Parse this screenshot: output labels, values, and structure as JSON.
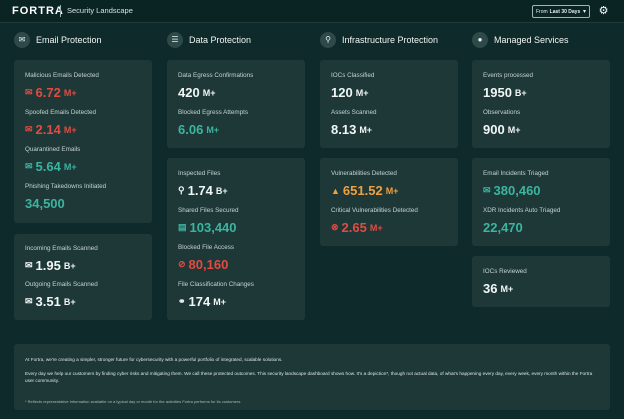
{
  "header": {
    "brand": "FORTRA",
    "title": "Security Landscape",
    "range_prefix": "From",
    "range_value": "Last 30 Days"
  },
  "columns": {
    "email": {
      "title": "Email Protection"
    },
    "data": {
      "title": "Data Protection"
    },
    "infra": {
      "title": "Infrastructure Protection"
    },
    "managed": {
      "title": "Managed Services"
    }
  },
  "email": {
    "malicious": {
      "label": "Malicious Emails Detected",
      "value": "6.72",
      "unit": "M+"
    },
    "spoofed": {
      "label": "Spoofed Emails Detected",
      "value": "2.14",
      "unit": "M+"
    },
    "quarantined": {
      "label": "Quarantined Emails",
      "value": "5.64",
      "unit": "M+"
    },
    "phishing": {
      "label": "Phishing Takedowns Initiated",
      "value": "34,500",
      "unit": ""
    },
    "incoming": {
      "label": "Incoming Emails Scanned",
      "value": "1.95",
      "unit": "B+"
    },
    "outgoing": {
      "label": "Outgoing Emails Scanned",
      "value": "3.51",
      "unit": "B+"
    }
  },
  "data": {
    "egress_conf": {
      "label": "Data Egress Confirmations",
      "value": "420",
      "unit": "M+"
    },
    "egress_blocked": {
      "label": "Blocked Egress Attempts",
      "value": "6.06",
      "unit": "M+"
    },
    "inspected": {
      "label": "Inspected Files",
      "value": "1.74",
      "unit": "B+"
    },
    "shared": {
      "label": "Shared Files Secured",
      "value": "103,440",
      "unit": ""
    },
    "blocked_access": {
      "label": "Blocked File Access",
      "value": "80,160",
      "unit": ""
    },
    "classification": {
      "label": "File Classification Changes",
      "value": "174",
      "unit": "M+"
    }
  },
  "infra": {
    "iocs": {
      "label": "IOCs Classified",
      "value": "120",
      "unit": "M+"
    },
    "assets": {
      "label": "Assets Scanned",
      "value": "8.13",
      "unit": "M+"
    },
    "vulns": {
      "label": "Vulnerabilities Detected",
      "value": "651.52",
      "unit": "M+"
    },
    "critical": {
      "label": "Critical Vulnerabilities Detected",
      "value": "2.65",
      "unit": "M+"
    }
  },
  "managed": {
    "events": {
      "label": "Events processed",
      "value": "1950",
      "unit": "B+"
    },
    "observations": {
      "label": "Observations",
      "value": "900",
      "unit": "M+"
    },
    "email_triaged": {
      "label": "Email Incidents Triaged",
      "value": "380,460",
      "unit": ""
    },
    "xdr_triaged": {
      "label": "XDR Incidents Auto Triaged",
      "value": "22,470",
      "unit": ""
    },
    "iocs_reviewed": {
      "label": "IOCs Reviewed",
      "value": "36",
      "unit": "M+"
    }
  },
  "footer": {
    "line1": "At Fortra, we're creating a simpler, stronger future for cybersecurity with a powerful portfolio of integrated, scalable solutions.",
    "line2": "Every day we help our customers by finding cyber risks and mitigating them. We call these protected outcomes. This security landscape dashboard shows how. It's a depiction*, though not actual data, of what's happening every day, every week, every month within the Fortra user community.",
    "note": "* Reflects representative information available on a typical day or month for the activities Fortra performs for its customers."
  },
  "colors": {
    "background": "#0f2a2a",
    "card": "#1d3837",
    "red": "#e24b41",
    "teal": "#3cb4a0",
    "orange": "#f0a040"
  },
  "icons": {
    "email_header": "envelope-icon",
    "data_header": "database-icon",
    "infra_header": "network-icon",
    "managed_header": "headset-icon",
    "settings": "gear-icon"
  }
}
